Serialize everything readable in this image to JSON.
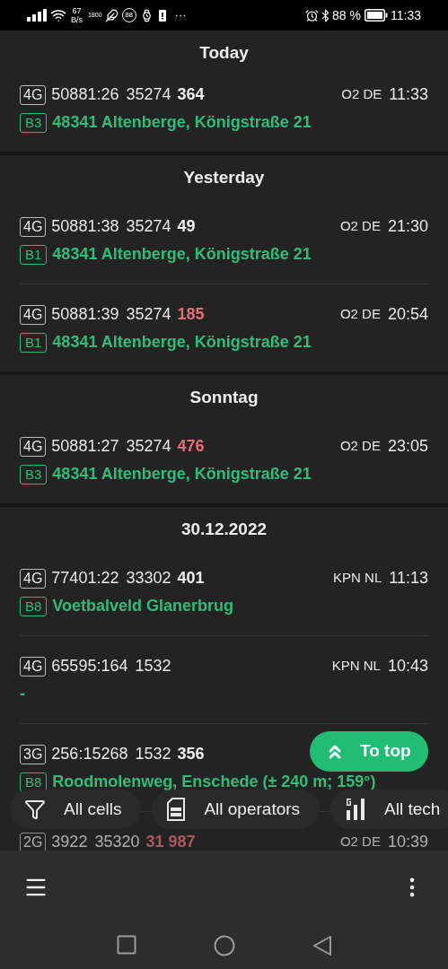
{
  "status_bar": {
    "speed_value": "67",
    "speed_unit": "B/s",
    "hotspot_label": "1800",
    "badge": "88",
    "more": "···",
    "battery": "88 %",
    "time": "11:33"
  },
  "groups": [
    {
      "title": "Today",
      "rows": [
        {
          "tech": "4G",
          "cell_id": "50881:26",
          "area": "35274",
          "signal": "364",
          "weak": false,
          "operator": "O2 DE",
          "time": "11:33",
          "band": "B3",
          "location": "48341 Altenberge, Königstraße 21"
        }
      ]
    },
    {
      "title": "Yesterday",
      "rows": [
        {
          "tech": "4G",
          "cell_id": "50881:38",
          "area": "35274",
          "signal": "49",
          "weak": false,
          "operator": "O2 DE",
          "time": "21:30",
          "band": "B1",
          "location": "48341 Altenberge, Königstraße 21"
        },
        {
          "tech": "4G",
          "cell_id": "50881:39",
          "area": "35274",
          "signal": "185",
          "weak": true,
          "operator": "O2 DE",
          "time": "20:54",
          "band": "B1",
          "location": "48341 Altenberge, Königstraße 21"
        }
      ]
    },
    {
      "title": "Sonntag",
      "rows": [
        {
          "tech": "4G",
          "cell_id": "50881:27",
          "area": "35274",
          "signal": "476",
          "weak": true,
          "operator": "O2 DE",
          "time": "23:05",
          "band": "B3",
          "location": "48341 Altenberge, Königstraße 21"
        }
      ]
    },
    {
      "title": "30.12.2022",
      "rows": [
        {
          "tech": "4G",
          "cell_id": "77401:22",
          "area": "33302",
          "signal": "401",
          "weak": false,
          "operator": "KPN NL",
          "time": "11:13",
          "band": "B8",
          "location": "Voetbalveld Glanerbrug"
        },
        {
          "tech": "4G",
          "cell_id": "65595:164",
          "area": "1532",
          "operator": "KPN NL",
          "time": "10:43",
          "location": "-"
        },
        {
          "tech": "3G",
          "cell_id": "256:15268",
          "area": "1532",
          "signal": "356",
          "weak": false,
          "band": "B8",
          "location": "Roodmolenweg, Enschede (± 240 m; 159°)"
        },
        {
          "tech": "2G",
          "cell_id": "3922",
          "area": "35320",
          "signal": "31 987",
          "weak": true,
          "operator": "O2 DE",
          "time": "10:39"
        }
      ]
    }
  ],
  "to_top": {
    "label": "To top"
  },
  "filters": [
    {
      "kind": "cells",
      "label": "All cells"
    },
    {
      "kind": "operators",
      "label": "All operators"
    },
    {
      "kind": "tech",
      "label": "All tech"
    }
  ]
}
